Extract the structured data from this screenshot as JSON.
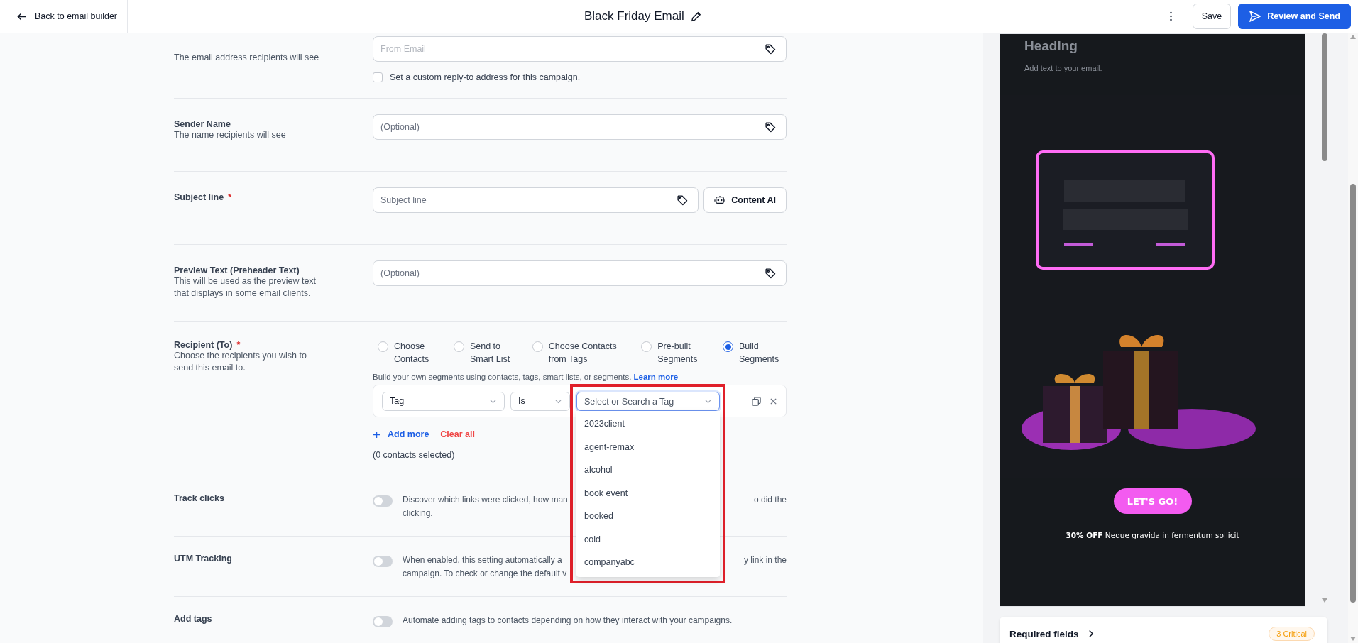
{
  "header": {
    "back_link": "Back to email builder",
    "title": "Black Friday Email",
    "buttons": [
      {
        "label": "Save",
        "kind": "secondary"
      },
      {
        "label": "Review and Send",
        "kind": "primary"
      }
    ]
  },
  "from_email": {
    "description": "The email address recipients will see",
    "placeholder": "From Email",
    "checkbox": {
      "label": "Set a custom reply-to address for this campaign.",
      "checked": false
    }
  },
  "fields": [
    {
      "label": "Sender Name",
      "description": "The name recipients will see",
      "placeholder": "(Optional)"
    },
    {
      "label": "Subject line",
      "required_mark": "*",
      "placeholder": "Subject line",
      "content_ai": "Content AI"
    },
    {
      "label": "Preview Text (Preheader Text)",
      "description": "This will be used as the preview text that displays in some email clients.",
      "placeholder": "(Optional)"
    }
  ],
  "recipient": {
    "label": "Recipient (To)",
    "required_mark": "*",
    "description": "Choose the recipients you wish to send this email to.",
    "options": [
      {
        "label": "Choose Contacts",
        "selected": false
      },
      {
        "label": "Send to Smart List",
        "selected": false
      },
      {
        "label": "Choose Contacts from Tags",
        "selected": false
      },
      {
        "label": "Pre-built Segments",
        "selected": false
      },
      {
        "label": "Build Segments",
        "selected": true
      }
    ],
    "helper": "Build your own segments using contacts, tags, smart lists, or segments.",
    "learn_more": "Learn more",
    "filter": {
      "field": "Tag",
      "operator": "Is"
    },
    "tag_dropdown": {
      "placeholder": "Select or Search a Tag",
      "options": [
        {
          "label": "2023client",
          "selected": false
        },
        {
          "label": "agent-remax",
          "selected": false
        },
        {
          "label": "alcohol",
          "selected": false
        },
        {
          "label": "book event",
          "selected": false
        },
        {
          "label": "booked",
          "selected": false
        },
        {
          "label": "cold",
          "selected": false
        },
        {
          "label": "companyabc",
          "selected": false
        }
      ]
    },
    "add_more": "Add more",
    "clear_all": "Clear all",
    "count": "(0 contacts selected)"
  },
  "settings": [
    {
      "label": "Track clicks",
      "on": false,
      "kind": "covered",
      "line_1_left": "Discover which links were clicked, how man",
      "line_1_right": "o did the",
      "line_2": "clicking."
    },
    {
      "label": "UTM Tracking",
      "on": false,
      "kind": "covered",
      "line_1_left": "When enabled, this setting automatically a",
      "line_1_right": "y link in the",
      "line_2": "campaign. To check or change the default v"
    },
    {
      "label": "Add tags",
      "on": false,
      "kind": "plain",
      "text": "Automate adding tags to contacts depending on how they interact with your campaigns."
    }
  ],
  "preview": {
    "heading": "Heading",
    "body": "Add text to your email.",
    "button": "LET'S GO!",
    "caption": "**30% OFF** Neque gravida in fermentum sollicit"
  },
  "required_fields": {
    "label": "Required fields",
    "badge": "3 Critical"
  }
}
